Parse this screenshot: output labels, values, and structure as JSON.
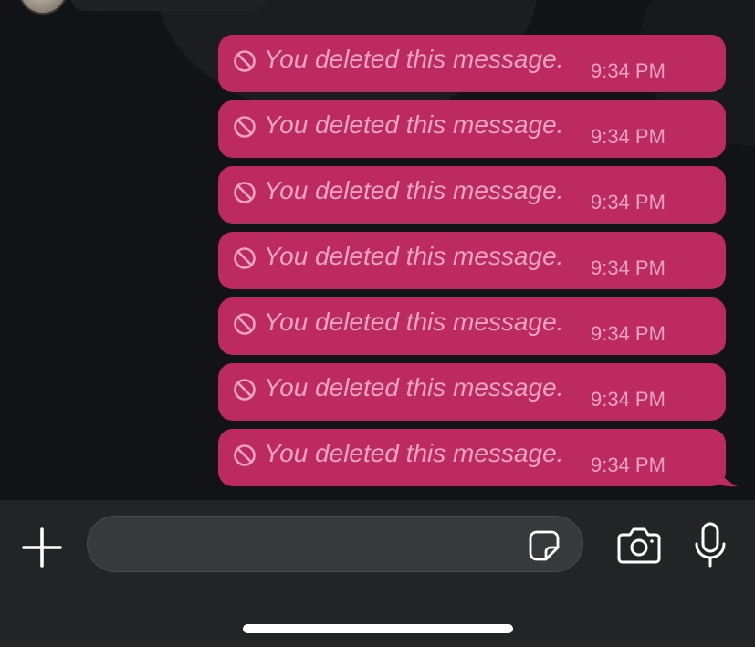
{
  "colors": {
    "background": "#121316",
    "bubble": "#bc2a5f",
    "bubble_text": "#e8a4bf",
    "input_bar": "#232426",
    "input_field": "#38393b",
    "icon": "#ffffff"
  },
  "messages": [
    {
      "text": "You deleted this message.",
      "time": "9:34 PM",
      "icon": "ban-icon"
    },
    {
      "text": "You deleted this message.",
      "time": "9:34 PM",
      "icon": "ban-icon"
    },
    {
      "text": "You deleted this message.",
      "time": "9:34 PM",
      "icon": "ban-icon"
    },
    {
      "text": "You deleted this message.",
      "time": "9:34 PM",
      "icon": "ban-icon"
    },
    {
      "text": "You deleted this message.",
      "time": "9:34 PM",
      "icon": "ban-icon"
    },
    {
      "text": "You deleted this message.",
      "time": "9:34 PM",
      "icon": "ban-icon"
    },
    {
      "text": "You deleted this message.",
      "time": "9:34 PM",
      "icon": "ban-icon"
    }
  ],
  "composer": {
    "value": "",
    "placeholder": "",
    "icons": [
      "plus-icon",
      "sticker-icon",
      "camera-icon",
      "microphone-icon"
    ]
  }
}
